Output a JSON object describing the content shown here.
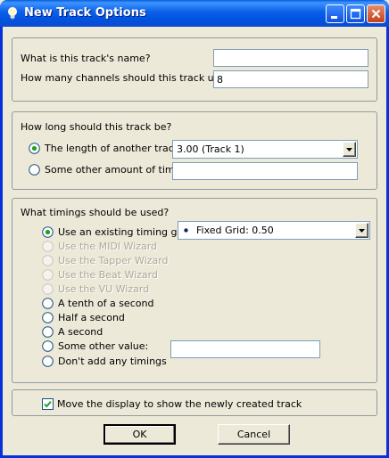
{
  "window": {
    "title": "New Track Options",
    "icon": "light-bulb-icon",
    "controls": [
      "minimize-icon",
      "maximize-icon",
      "close-icon"
    ]
  },
  "name_section": {
    "name_label": "What is this track's name?",
    "name_value": "",
    "channels_label": "How many channels should this track use?",
    "channels_value": "8"
  },
  "length_section": {
    "heading": "How long should this track be?",
    "option_another_track": "The length of another track:",
    "another_track_selected": "3.00 (Track 1)",
    "option_other_time": "Some other amount of time:",
    "other_time_value": "",
    "selected": "another_track"
  },
  "timings_section": {
    "heading": "What timings should be used?",
    "options": [
      {
        "label": "Use an existing timing grid:",
        "enabled": true,
        "selected": true
      },
      {
        "label": "Use the MIDI Wizard",
        "enabled": false,
        "selected": false
      },
      {
        "label": "Use the Tapper Wizard",
        "enabled": false,
        "selected": false
      },
      {
        "label": "Use the Beat Wizard",
        "enabled": false,
        "selected": false
      },
      {
        "label": "Use the VU Wizard",
        "enabled": false,
        "selected": false
      },
      {
        "label": "A tenth of a second",
        "enabled": true,
        "selected": false
      },
      {
        "label": "Half a second",
        "enabled": true,
        "selected": false
      },
      {
        "label": "A second",
        "enabled": true,
        "selected": false
      },
      {
        "label": "Some other value:",
        "enabled": true,
        "selected": false
      },
      {
        "label": "Don't add any timings",
        "enabled": true,
        "selected": false
      }
    ],
    "grid_selected": "Fixed Grid: 0.50",
    "other_value": ""
  },
  "display_section": {
    "checkbox_label": "Move the display to show the newly created track",
    "checked": true
  },
  "buttons": {
    "ok": "OK",
    "cancel": "Cancel"
  }
}
